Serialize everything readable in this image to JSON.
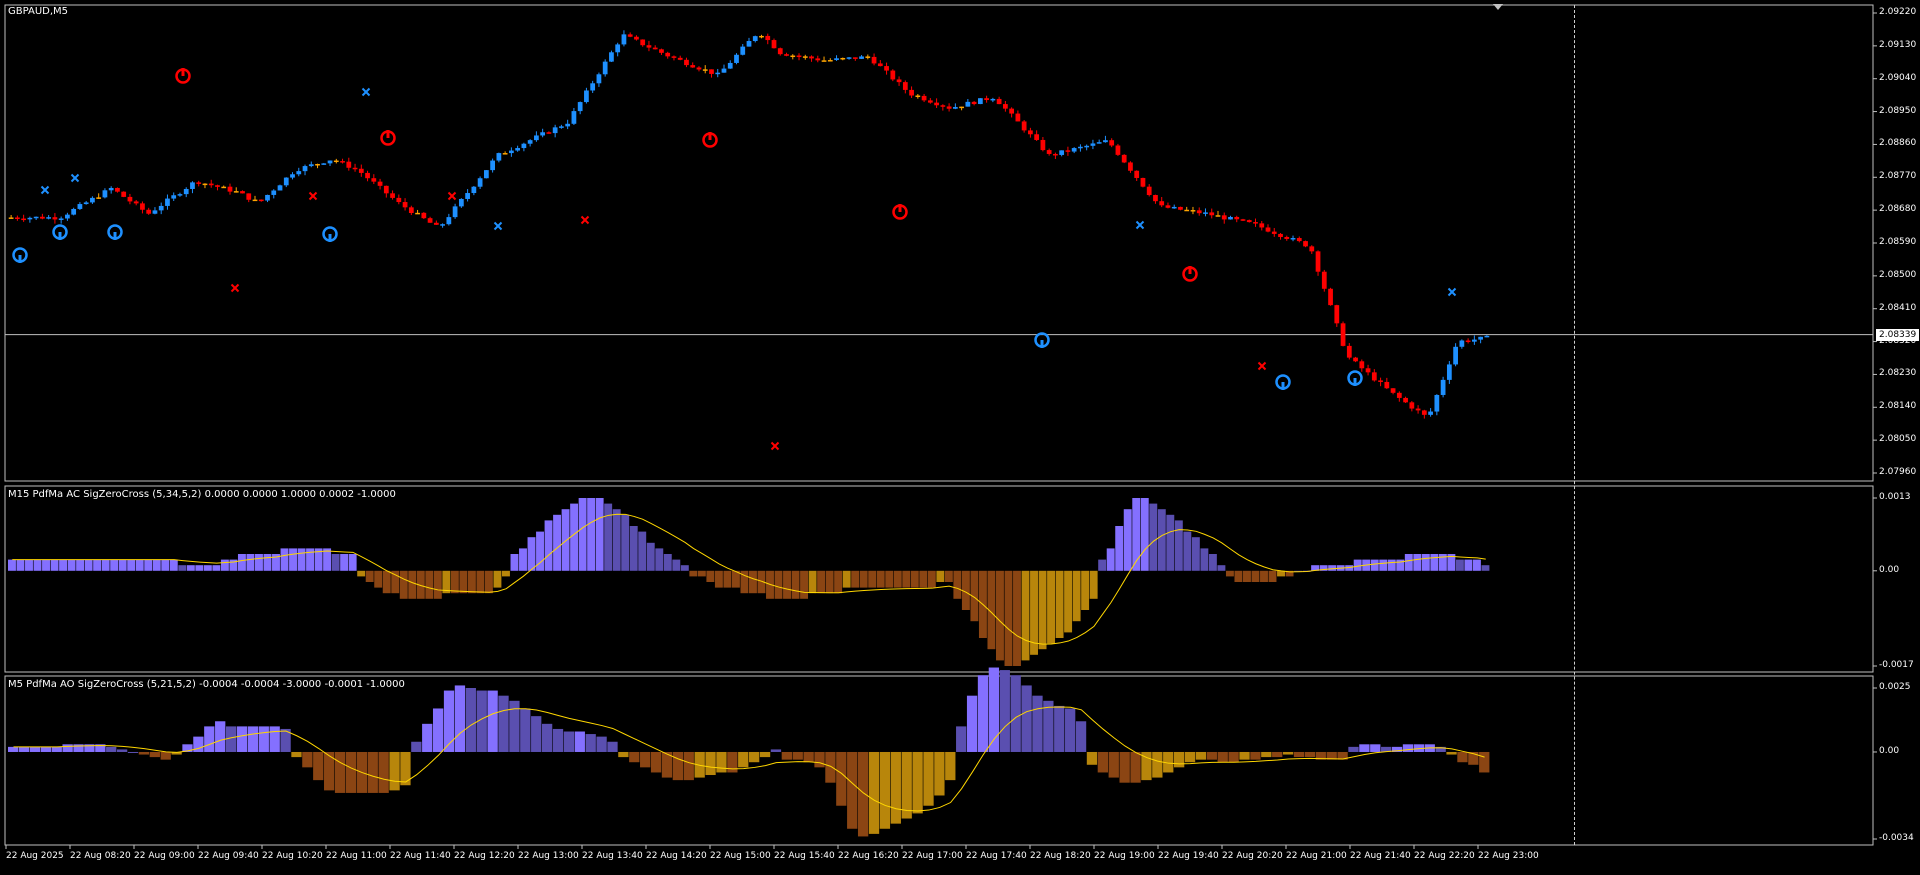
{
  "window": {
    "symbol_label": "GBPAUD,M5"
  },
  "price_pane": {
    "y_ticks": [
      "2.09220",
      "2.09130",
      "2.09040",
      "2.08950",
      "2.08860",
      "2.08770",
      "2.08680",
      "2.08590",
      "2.08500",
      "2.08410",
      "2.08320",
      "2.08230",
      "2.08140",
      "2.08050",
      "2.07960"
    ],
    "y_max": 2.0922,
    "y_min": 2.0796,
    "current_price": "2.08339",
    "current_price_value": 2.08339,
    "colors": {
      "bull": "#1e90ff",
      "bear": "#ff0000",
      "neutral": "#ffa500",
      "line": "#c0c0c0"
    }
  },
  "ac_pane": {
    "label": "M15 PdfMa AC SigZeroCross (5,34,5,2) 0.0000 0.0000 1.0000 0.0002 -1.0000",
    "y_ticks": [
      "0.0013",
      "0.00",
      "-0.0017"
    ],
    "y_max": 0.0013,
    "y_min": -0.0017
  },
  "ao_pane": {
    "label": "M5 PdfMa AO SigZeroCross (5,21,5,2) -0.0004 -0.0004 -3.0000 -0.0001 -1.0000",
    "y_ticks": [
      "0.0025",
      "0.00",
      "-0.0034"
    ],
    "y_max": 0.0025,
    "y_min": -0.0034
  },
  "time_axis": {
    "labels": [
      "22 Aug 2025",
      "22 Aug 08:20",
      "22 Aug 09:00",
      "22 Aug 09:40",
      "22 Aug 10:20",
      "22 Aug 11:00",
      "22 Aug 11:40",
      "22 Aug 12:20",
      "22 Aug 13:00",
      "22 Aug 13:40",
      "22 Aug 14:20",
      "22 Aug 15:00",
      "22 Aug 15:40",
      "22 Aug 16:20",
      "22 Aug 17:00",
      "22 Aug 17:40",
      "22 Aug 18:20",
      "22 Aug 19:00",
      "22 Aug 19:40",
      "22 Aug 20:20",
      "22 Aug 21:00",
      "22 Aug 21:40",
      "22 Aug 22:20",
      "22 Aug 23:00"
    ]
  },
  "chart_data": [
    {
      "type": "candlestick",
      "symbol": "GBPAUD",
      "timeframe": "M5",
      "close_path": [
        [
          0,
          2.0866
        ],
        [
          15,
          2.0866
        ],
        [
          29,
          2.0874
        ],
        [
          39,
          2.0867
        ],
        [
          52,
          2.0876
        ],
        [
          63,
          2.0873
        ],
        [
          69,
          2.087
        ],
        [
          79,
          2.0879
        ],
        [
          89,
          2.0882
        ],
        [
          96,
          2.0879
        ],
        [
          107,
          2.087
        ],
        [
          118,
          2.0863
        ],
        [
          134,
          2.0883
        ],
        [
          153,
          2.0892
        ],
        [
          168,
          2.0916
        ],
        [
          181,
          2.091
        ],
        [
          194,
          2.0905
        ],
        [
          205,
          2.0917
        ],
        [
          211,
          2.0911
        ],
        [
          223,
          2.0909
        ],
        [
          235,
          2.091
        ],
        [
          246,
          2.09
        ],
        [
          257,
          2.0896
        ],
        [
          269,
          2.0899
        ],
        [
          284,
          2.0883
        ],
        [
          300,
          2.0887
        ],
        [
          314,
          2.0869
        ],
        [
          327,
          2.0867
        ],
        [
          340,
          2.0864
        ],
        [
          355,
          2.0858
        ],
        [
          365,
          2.0828
        ],
        [
          377,
          2.0818
        ],
        [
          387,
          2.0811
        ],
        [
          395,
          2.0832
        ],
        [
          403,
          2.0833
        ]
      ],
      "series_ranges": {
        "min": 2.0811,
        "max": 2.0917
      }
    },
    {
      "type": "bar",
      "name": "AC",
      "values": [
        0.0002,
        0.0002,
        0.0002,
        0.0002,
        0.0002,
        0.0002,
        0.0002,
        0.0002,
        0.0002,
        0.0002,
        0.0002,
        0.0002,
        0.0002,
        0.0002,
        0.0002,
        0.0002,
        0.0002,
        0.0002,
        0.0002,
        0.0002,
        0.0001,
        0.0001,
        0.0001,
        0.0001,
        0.0001,
        0.0002,
        0.0002,
        0.0003,
        0.0003,
        0.0003,
        0.0003,
        0.0003,
        0.0004,
        0.0004,
        0.0004,
        0.0004,
        0.0004,
        0.0004,
        0.0003,
        0.0003,
        0.0003,
        -0.0001,
        -0.0002,
        -0.0003,
        -0.0004,
        -0.0004,
        -0.0005,
        -0.0005,
        -0.0005,
        -0.0005,
        -0.0005,
        -0.0004,
        -0.0004,
        -0.0004,
        -0.0004,
        -0.0004,
        -0.0004,
        -0.0003,
        -0.0001,
        0.0003,
        0.0004,
        0.0006,
        0.0007,
        0.0009,
        0.001,
        0.0011,
        0.0012,
        0.0013,
        0.0013,
        0.0013,
        0.0012,
        0.0011,
        0.001,
        0.0008,
        0.0007,
        0.0005,
        0.0004,
        0.0003,
        0.0002,
        0.0001,
        -0.0001,
        -0.0001,
        -0.0002,
        -0.0003,
        -0.0003,
        -0.0003,
        -0.0004,
        -0.0004,
        -0.0004,
        -0.0005,
        -0.0005,
        -0.0005,
        -0.0005,
        -0.0005,
        -0.0004,
        -0.0004,
        -0.0004,
        -0.0004,
        -0.0003,
        -0.0003,
        -0.0003,
        -0.0003,
        -0.0003,
        -0.0003,
        -0.0003,
        -0.0003,
        -0.0003,
        -0.0003,
        -0.0003,
        -0.0002,
        -0.0002,
        -0.0005,
        -0.0007,
        -0.0009,
        -0.0012,
        -0.0014,
        -0.0016,
        -0.0017,
        -0.0017,
        -0.0016,
        -0.0015,
        -0.0014,
        -0.0013,
        -0.0012,
        -0.0011,
        -0.0009,
        -0.0007,
        -0.0005,
        0.0002,
        0.0004,
        0.0008,
        0.0011,
        0.0013,
        0.0013,
        0.0012,
        0.0011,
        0.001,
        0.0009,
        0.0007,
        0.0006,
        0.0004,
        0.0003,
        0.0001,
        -0.0001,
        -0.0002,
        -0.0002,
        -0.0002,
        -0.0002,
        -0.0002,
        -0.0001,
        -0.0001,
        0.0,
        0.0,
        0.0001,
        0.0001,
        0.0001,
        0.0001,
        0.0001,
        0.0002,
        0.0002,
        0.0002,
        0.0002,
        0.0002,
        0.0002,
        0.0003,
        0.0003,
        0.0003,
        0.0003,
        0.0003,
        0.0003,
        0.0002,
        0.0002,
        0.0002,
        0.0001
      ],
      "ylim": [
        -0.0017,
        0.0013
      ]
    },
    {
      "type": "bar",
      "name": "AO",
      "values": [
        0.0002,
        0.0002,
        0.0002,
        0.0002,
        0.0002,
        0.0003,
        0.0003,
        0.0003,
        0.0003,
        0.0002,
        0.0001,
        0.0,
        -0.0001,
        -0.0002,
        -0.0003,
        -0.0001,
        0.0003,
        0.0006,
        0.001,
        0.0012,
        0.001,
        0.001,
        0.001,
        0.001,
        0.001,
        0.0009,
        -0.0002,
        -0.0006,
        -0.0011,
        -0.0015,
        -0.0016,
        -0.0016,
        -0.0016,
        -0.0016,
        -0.0016,
        -0.0015,
        -0.0013,
        0.0004,
        0.0011,
        0.0017,
        0.0024,
        0.0026,
        0.0025,
        0.0024,
        0.0024,
        0.0022,
        0.002,
        0.0017,
        0.0014,
        0.0011,
        0.0009,
        0.0008,
        0.0008,
        0.0007,
        0.0006,
        0.0004,
        -0.0002,
        -0.0004,
        -0.0006,
        -0.0008,
        -0.001,
        -0.0011,
        -0.0011,
        -0.001,
        -0.0009,
        -0.0008,
        -0.0008,
        -0.0006,
        -0.0004,
        -0.0002,
        0.0001,
        -0.0003,
        -0.0003,
        -0.0004,
        -0.0006,
        -0.0012,
        -0.0021,
        -0.003,
        -0.0033,
        -0.0032,
        -0.003,
        -0.0028,
        -0.0026,
        -0.0024,
        -0.0021,
        -0.0017,
        -0.0011,
        0.001,
        0.0022,
        0.003,
        0.0033,
        0.0032,
        0.003,
        0.0026,
        0.0022,
        0.002,
        0.0018,
        0.0017,
        0.0012,
        -0.0005,
        -0.0008,
        -0.001,
        -0.0012,
        -0.0012,
        -0.0011,
        -0.001,
        -0.0008,
        -0.0006,
        -0.0004,
        -0.0003,
        -0.0003,
        -0.0004,
        -0.0004,
        -0.0003,
        -0.0003,
        -0.0002,
        -0.0002,
        -0.0001,
        -0.0002,
        -0.0002,
        -0.0003,
        -0.0003,
        -0.0003,
        0.0002,
        0.0003,
        0.0003,
        0.0002,
        0.0002,
        0.0003,
        0.0003,
        0.0003,
        0.0002,
        -0.0001,
        -0.0004,
        -0.0005,
        -0.0008
      ],
      "ylim": [
        -0.0034,
        0.0025
      ]
    }
  ]
}
